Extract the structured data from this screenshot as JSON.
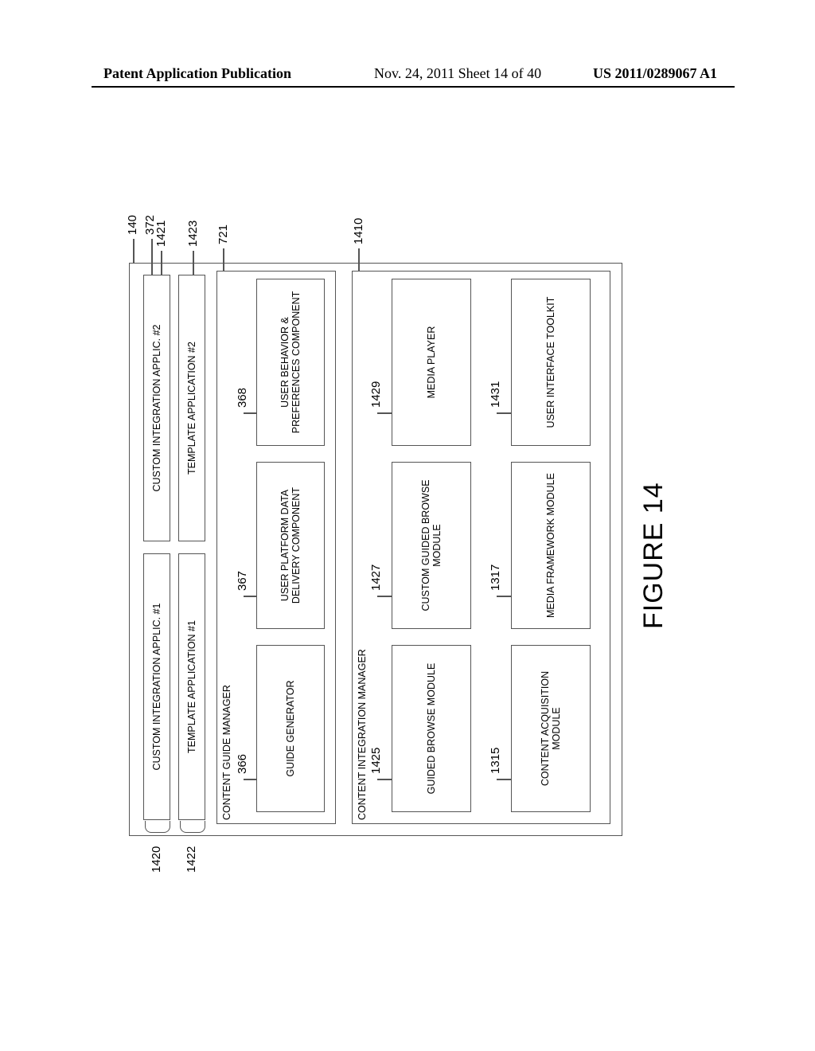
{
  "header": {
    "left": "Patent Application Publication",
    "mid": "Nov. 24, 2011   Sheet 14 of 40",
    "right": "US 2011/0289067 A1"
  },
  "figure_caption": "FIGURE 14",
  "refs": {
    "r140": "140",
    "r372": "372",
    "r1420": "1420",
    "r1421": "1421",
    "r1422": "1422",
    "r1423": "1423",
    "r721": "721",
    "r366": "366",
    "r367": "367",
    "r368": "368",
    "r1410": "1410",
    "r1425": "1425",
    "r1427": "1427",
    "r1429": "1429",
    "r1315": "1315",
    "r1317": "1317",
    "r1431": "1431"
  },
  "labels": {
    "cia1": "CUSTOM INTEGRATION APPLIC. #1",
    "cia2": "CUSTOM INTEGRATION APPLIC. #2",
    "ta1": "TEMPLATE APPLICATION #1",
    "ta2": "TEMPLATE APPLICATION #2",
    "cgm": "CONTENT GUIDE MANAGER",
    "gg": "GUIDE GENERATOR",
    "updd": "USER PLATFORM DATA DELIVERY COMPONENT",
    "ubp": "USER BEHAVIOR & PREFERENCES COMPONENT",
    "cim": "CONTENT INTEGRATION MANAGER",
    "gbm": "GUIDED BROWSE MODULE",
    "cgbm": "CUSTOM GUIDED BROWSE MODULE",
    "mp": "MEDIA PLAYER",
    "cam": "CONTENT ACQUISITION MODULE",
    "mfm": "MEDIA FRAMEWORK MODULE",
    "uit": "USER INTERFACE TOOLKIT"
  },
  "chart_data": {
    "type": "table",
    "title": "FIGURE 14 — block diagram hierarchy",
    "nodes": [
      {
        "id": "140",
        "label": "(outer container)",
        "parent": null
      },
      {
        "id": "372",
        "label": "(upper app container)",
        "parent": "140"
      },
      {
        "id": "1420",
        "label": "CUSTOM INTEGRATION APPLIC. #1",
        "parent": "372"
      },
      {
        "id": "1421",
        "label": "CUSTOM INTEGRATION APPLIC. #2",
        "parent": "372"
      },
      {
        "id": "1422",
        "label": "TEMPLATE APPLICATION #1",
        "parent": "372"
      },
      {
        "id": "1423",
        "label": "TEMPLATE APPLICATION #2",
        "parent": "372"
      },
      {
        "id": "721",
        "label": "CONTENT GUIDE MANAGER",
        "parent": "140"
      },
      {
        "id": "366",
        "label": "GUIDE GENERATOR",
        "parent": "721"
      },
      {
        "id": "367",
        "label": "USER PLATFORM DATA DELIVERY COMPONENT",
        "parent": "721"
      },
      {
        "id": "368",
        "label": "USER BEHAVIOR & PREFERENCES COMPONENT",
        "parent": "721"
      },
      {
        "id": "1410",
        "label": "CONTENT INTEGRATION MANAGER",
        "parent": "140"
      },
      {
        "id": "1425",
        "label": "GUIDED BROWSE MODULE",
        "parent": "1410"
      },
      {
        "id": "1427",
        "label": "CUSTOM GUIDED BROWSE MODULE",
        "parent": "1410"
      },
      {
        "id": "1429",
        "label": "MEDIA PLAYER",
        "parent": "1410"
      },
      {
        "id": "1315",
        "label": "CONTENT ACQUISITION MODULE",
        "parent": "1410"
      },
      {
        "id": "1317",
        "label": "MEDIA FRAMEWORK MODULE",
        "parent": "1410"
      },
      {
        "id": "1431",
        "label": "USER INTERFACE TOOLKIT",
        "parent": "1410"
      }
    ]
  }
}
